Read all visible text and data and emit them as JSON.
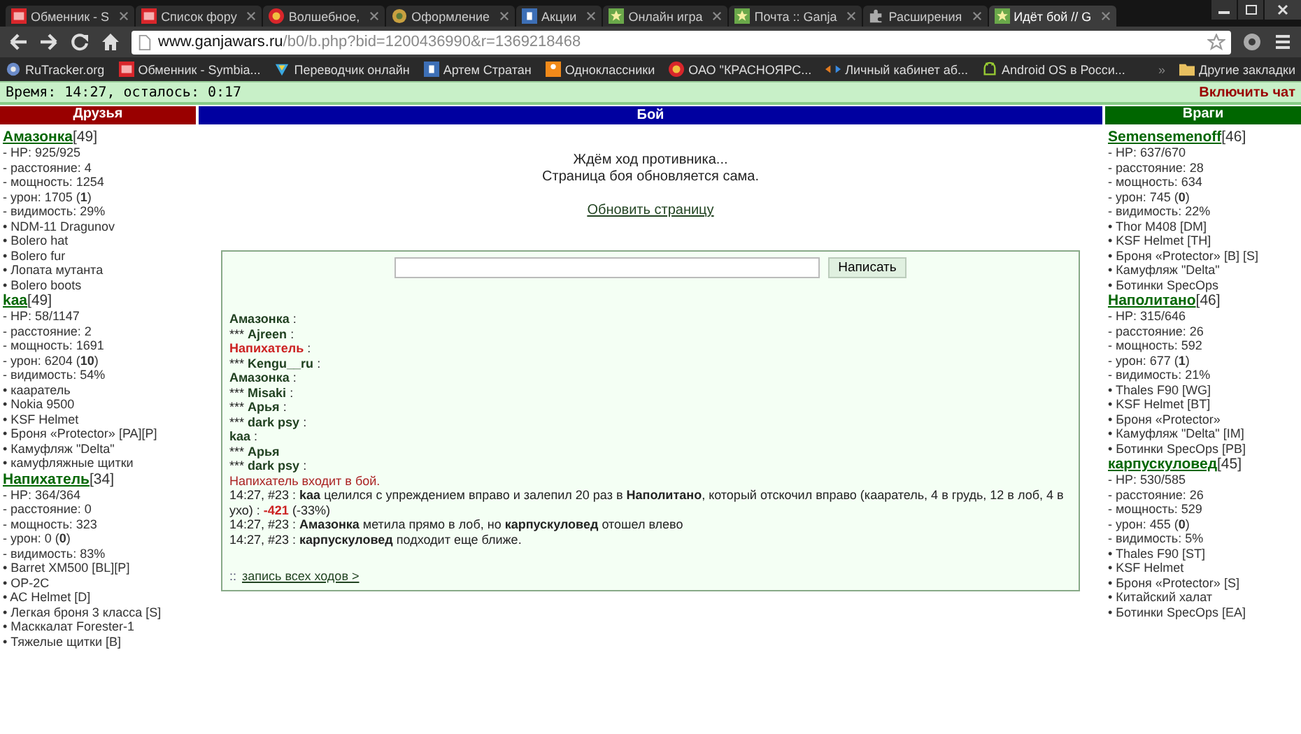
{
  "tabs": [
    {
      "title": "Обменник - S",
      "selected": false
    },
    {
      "title": "Список фору",
      "selected": false
    },
    {
      "title": "Волшебное,",
      "selected": false
    },
    {
      "title": "Оформление",
      "selected": false
    },
    {
      "title": "Акции",
      "selected": false
    },
    {
      "title": "Онлайн игра",
      "selected": false
    },
    {
      "title": "Почта :: Ganja",
      "selected": false
    },
    {
      "title": "Расширения",
      "selected": false
    },
    {
      "title": "Идёт бой // G",
      "selected": true
    }
  ],
  "address": {
    "host": "www.ganjawars.ru",
    "path": "/b0/b.php?bid=1200436990&r=1369218468"
  },
  "bookmarks": [
    {
      "label": "RuTracker.org"
    },
    {
      "label": "Обменник - Symbia..."
    },
    {
      "label": "Переводчик онлайн"
    },
    {
      "label": "Артем Стратан"
    },
    {
      "label": "Одноклассники"
    },
    {
      "label": "ОАО \"КРАСНОЯРС..."
    },
    {
      "label": "Личный кабинет аб..."
    },
    {
      "label": "Android OS в Росси..."
    }
  ],
  "bookmarks_overflow": "»",
  "other_bookmarks": "Другие закладки",
  "status": {
    "time": "Время: 14:27, осталось:  0:17",
    "chat_link": "Включить чат"
  },
  "friends": {
    "title": "Друзья",
    "players": [
      {
        "name": "Амазонка",
        "level": "[49]",
        "stats": [
          "- HP: 925/925",
          "- расстояние: 4",
          "- мощность: 1254",
          "- урон: 1705 (**1**)",
          "- видимость: 29%"
        ],
        "items": [
          "• NDM-11 Dragunov",
          "• Bolero hat",
          "• Bolero fur",
          "• Лопата мутанта",
          "• Bolero boots"
        ]
      },
      {
        "name": "kaa",
        "level": "[49]",
        "stats": [
          "- HP: 58/1147",
          "- расстояние: 2",
          "- мощность: 1691",
          "- урон: 6204 (**10**)",
          "- видимость: 54%"
        ],
        "items": [
          "• кааратель",
          "• Nokia 9500",
          "• KSF Helmet",
          "• Броня «Protector» [PA][P]",
          "• Камуфляж \"Delta\"",
          "• камуфляжные щитки"
        ]
      },
      {
        "name": "Напихатель",
        "level": "[34]",
        "stats": [
          "- HP: 364/364",
          "- расстояние: 0",
          "- мощность: 323",
          "- урон: 0 (**0**)",
          "- видимость: 83%"
        ],
        "items": [
          "• Barret XM500 [BL][P]",
          "• OP-2C",
          "• AC Helmet [D]",
          "• Легкая броня 3 класса [S]",
          "• Масккалат Forester-1",
          "• Тяжелые щитки [B]"
        ]
      }
    ]
  },
  "battle": {
    "title": "Бой",
    "waiting": "Ждём ход противника...",
    "auto_refresh": "Страница боя обновляется сама.",
    "refresh_link": "Обновить страницу",
    "chat": {
      "send_button": "Написать",
      "messages": [
        {
          "name": "Амазонка",
          "sep": ":",
          "color": "#1f3f1f"
        },
        {
          "marker": "***",
          "name": "Ajreen",
          "sep": ":",
          "color": "#1f3f1f"
        },
        {
          "name": "Напихатель",
          "sep": ":",
          "color": "#cc2222"
        },
        {
          "marker": "***",
          "name": "Kengu__ru",
          "sep": ":",
          "color": "#1f3f1f"
        },
        {
          "name": "Амазонка",
          "sep": ":",
          "color": "#1f3f1f"
        },
        {
          "marker": "***",
          "name": "Misaki",
          "sep": ":",
          "color": "#1f3f1f"
        },
        {
          "marker": "***",
          "name": "Арья",
          "sep": ":",
          "color": "#1f3f1f"
        },
        {
          "marker": "***",
          "name": "dark psy",
          "sep": ":",
          "color": "#1f3f1f"
        },
        {
          "name": "kaa",
          "sep": ":",
          "color": "#1f3f1f"
        },
        {
          "marker": "***",
          "name": "Арья",
          "color": "#1f3f1f"
        },
        {
          "marker": "***",
          "name": "dark psy",
          "sep": ":",
          "color": "#1f3f1f"
        }
      ],
      "log": [
        {
          "kind": "event",
          "text": "Напихатель входит в бой."
        },
        {
          "kind": "hit",
          "text": "14:27, #23 : **kaa** целился с упреждением вправо и залепил 20 раз в **Наполитано**, который отскочил вправо (кааратель, 4 в грудь, 12 в лоб, 4 в ухо) :",
          "damage": "-421",
          "tail": "(-33%)"
        },
        {
          "kind": "plain",
          "text": "14:27, #23 : **Амазонка** метила прямо в лоб, но **карпускуловед** отошел влево"
        },
        {
          "kind": "plain",
          "text": "14:27, #23 : **карпускуловед** подходит еще ближе."
        }
      ],
      "footer_prefix": "::",
      "footer_link": "запись всех ходов >"
    }
  },
  "enemies": {
    "title": "Враги",
    "players": [
      {
        "name": "Semensemenoff",
        "level": "[46]",
        "stats": [
          "- HP: 637/670",
          "- расстояние: 28",
          "- мощность: 634",
          "- урон: 745 (**0**)",
          "- видимость: 22%"
        ],
        "items": [
          "• Thor M408 [DM]",
          "• KSF Helmet [TH]",
          "• Броня «Protector» [B] [S]",
          "• Камуфляж \"Delta\"",
          "• Ботинки SpecOps"
        ]
      },
      {
        "name": "Наполитано",
        "level": "[46]",
        "stats": [
          "- HP: 315/646",
          "- расстояние: 26",
          "- мощность: 592",
          "- урон: 677 (**1**)",
          "- видимость: 21%"
        ],
        "items": [
          "• Thales F90 [WG]",
          "• KSF Helmet [BT]",
          "• Броня «Protector»",
          "• Камуфляж \"Delta\" [IM]",
          "• Ботинки SpecOps [PB]"
        ]
      },
      {
        "name": "карпускуловед",
        "level": "[45]",
        "stats": [
          "- HP: 530/585",
          "- расстояние: 26",
          "- мощность: 529",
          "- урон: 455 (**0**)",
          "- видимость: 5%"
        ],
        "items": [
          "• Thales F90 [ST]",
          "• KSF Helmet",
          "• Броня «Protector» [S]",
          "• Китайский халат",
          "• Ботинки SpecOps [EA]"
        ]
      }
    ]
  }
}
